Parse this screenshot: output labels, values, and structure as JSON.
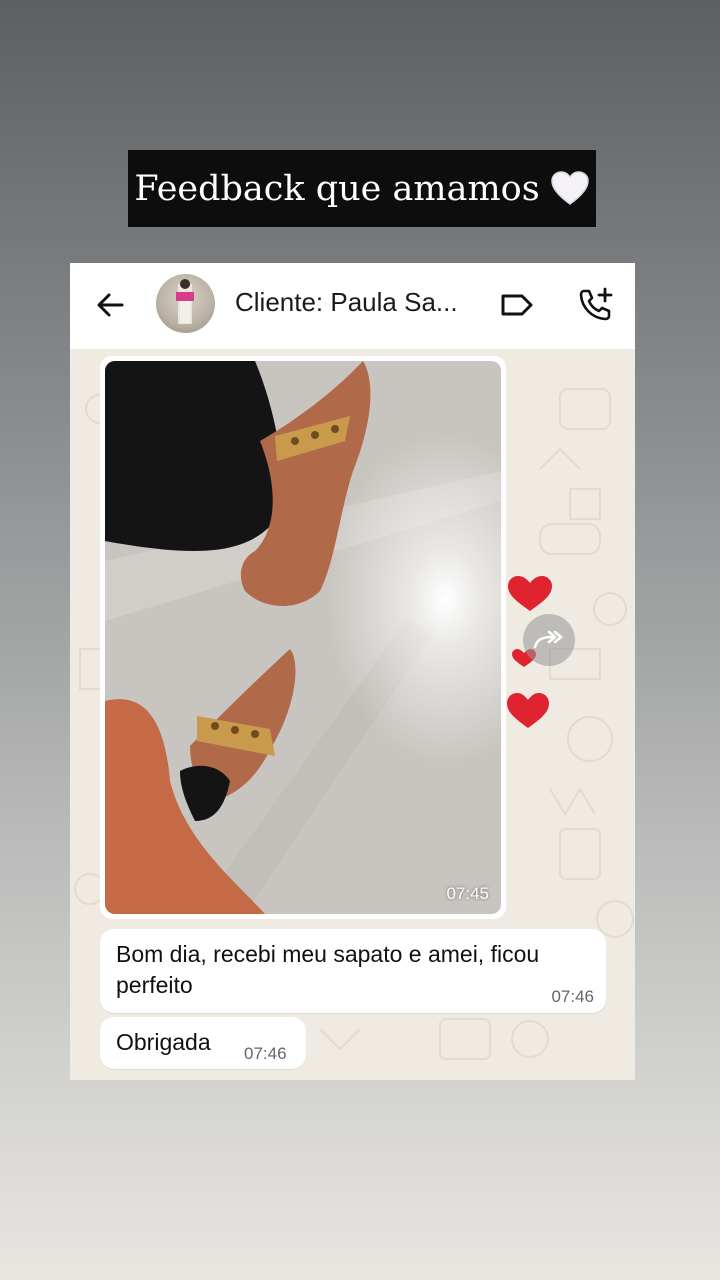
{
  "banner": {
    "title": "Feedback que amamos",
    "emoji_icon": "white-heart-icon"
  },
  "chat_header": {
    "contact_name": "Cliente: Paula Sa...",
    "back_icon": "arrow-left-icon",
    "label_icon": "label-tag-icon",
    "call_icon": "add-call-icon"
  },
  "messages": {
    "photo": {
      "time": "07:45",
      "reaction_icon": "red-hearts-icon",
      "forward_icon": "forward-arrow-icon"
    },
    "text1": {
      "text": "Bom dia, recebi meu sapato e amei, ficou perfeito",
      "time": "07:46"
    },
    "text2": {
      "text": "Obrigada",
      "time": "07:46"
    }
  },
  "colors": {
    "chat_background": "#efeae2",
    "bubble": "#ffffff",
    "banner_background": "#0d0d0d",
    "heart_red": "#e0242f"
  }
}
